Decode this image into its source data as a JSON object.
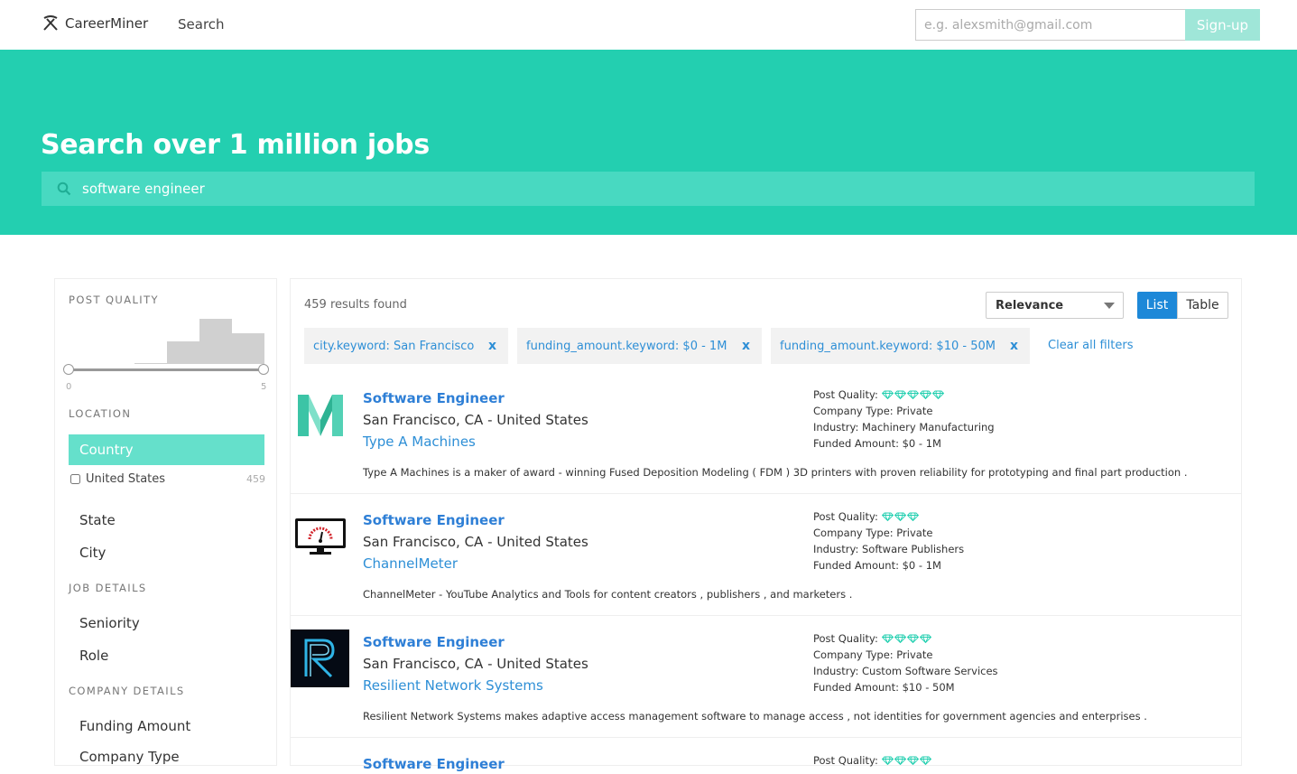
{
  "nav": {
    "brand": "CareerMiner",
    "search_link": "Search",
    "email_placeholder": "e.g. alexsmith@gmail.com",
    "signup_label": "Sign-up"
  },
  "hero": {
    "title": "Search over 1 million jobs",
    "query": "software engineer"
  },
  "sidebar": {
    "post_quality_heading": "POST QUALITY",
    "slider_min": "0",
    "slider_max": "5",
    "location_heading": "LOCATION",
    "country_label": "Country",
    "country_option": {
      "label": "United States",
      "count": "459"
    },
    "state_label": "State",
    "city_label": "City",
    "job_details_heading": "JOB DETAILS",
    "seniority_label": "Seniority",
    "role_label": "Role",
    "company_details_heading": "COMPANY DETAILS",
    "funding_label": "Funding Amount",
    "company_type_label": "Company Type"
  },
  "results": {
    "count_text": "459 results found",
    "sort_value": "Relevance",
    "view_list": "List",
    "view_table": "Table",
    "filters": [
      {
        "label": "city.keyword: San Francisco",
        "remove": "x"
      },
      {
        "label": "funding_amount.keyword: $0 - 1M",
        "remove": "x"
      },
      {
        "label": "funding_amount.keyword: $10 - 50M",
        "remove": "x"
      }
    ],
    "clear_label": "Clear all filters",
    "jobs": [
      {
        "title": "Software Engineer",
        "location": "San Francisco, CA - United States",
        "company": "Type A Machines",
        "quality_label": "Post Quality:",
        "quality": 5,
        "company_type": "Company Type: Private",
        "industry": "Industry: Machinery Manufacturing",
        "funded": "Funded Amount: $0 - 1M",
        "description": "Type A Machines is a maker of award - winning Fused Deposition Modeling ( FDM ) 3D printers with proven reliability for prototyping and final part production ."
      },
      {
        "title": "Software Engineer",
        "location": "San Francisco, CA - United States",
        "company": "ChannelMeter",
        "quality_label": "Post Quality:",
        "quality": 3,
        "company_type": "Company Type: Private",
        "industry": "Industry: Software Publishers",
        "funded": "Funded Amount: $0 - 1M",
        "description": "ChannelMeter - YouTube Analytics and Tools for content creators , publishers , and marketers ."
      },
      {
        "title": "Software Engineer",
        "location": "San Francisco, CA - United States",
        "company": "Resilient Network Systems",
        "quality_label": "Post Quality:",
        "quality": 4,
        "company_type": "Company Type: Private",
        "industry": "Industry: Custom Software Services",
        "funded": "Funded Amount: $10 - 50M",
        "description": "Resilient Network Systems makes adaptive access management software to manage access , not identities for government agencies and enterprises ."
      },
      {
        "title": "Software Engineer",
        "quality_label": "Post Quality:",
        "quality": 4
      }
    ]
  },
  "colors": {
    "accent": "#23cfb0",
    "link": "#2e8fd6",
    "primary_button": "#1d88d8"
  }
}
